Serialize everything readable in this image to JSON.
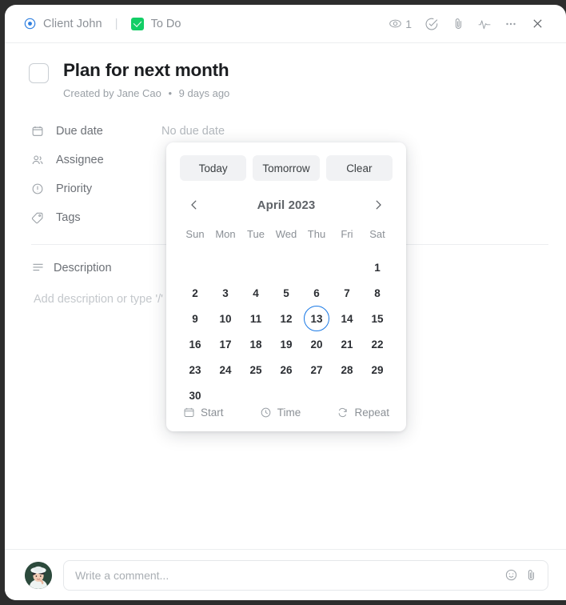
{
  "topbar": {
    "client": "Client John",
    "separator": "|",
    "status": "To Do",
    "view_count": "1",
    "icons": [
      "eye-icon",
      "check-circle-icon",
      "paperclip-icon",
      "activity-icon",
      "more-icon",
      "close-icon"
    ],
    "status_color": "#13ce66"
  },
  "task": {
    "title": "Plan for next month",
    "meta_author": "Created by Jane Cao",
    "meta_dot": "•",
    "meta_time": "9 days ago"
  },
  "fields": [
    {
      "label": "Due date",
      "value": "No due date",
      "icon": "calendar-icon"
    },
    {
      "label": "Assignee",
      "value": "",
      "icon": "people-icon"
    },
    {
      "label": "Priority",
      "value": "",
      "icon": "priority-flag-icon"
    },
    {
      "label": "Tags",
      "value": "",
      "icon": "tag-icon"
    }
  ],
  "description": {
    "title": "Description",
    "icon": "description-lines-icon",
    "placeholder": "Add description or type '/'"
  },
  "calendar": {
    "quick": [
      {
        "label": "Today"
      },
      {
        "label": "Tomorrow"
      },
      {
        "label": "Clear"
      }
    ],
    "prev_icon": "chevron-left-icon",
    "next_icon": "chevron-right-icon",
    "month": "April 2023",
    "weekdays": [
      "Sun",
      "Mon",
      "Tue",
      "Wed",
      "Thu",
      "Fri",
      "Sat"
    ],
    "leading_blanks": 6,
    "days": [
      1,
      2,
      3,
      4,
      5,
      6,
      7,
      8,
      9,
      10,
      11,
      12,
      13,
      14,
      15,
      16,
      17,
      18,
      19,
      20,
      21,
      22,
      23,
      24,
      25,
      26,
      27,
      28,
      29,
      30
    ],
    "today": 13,
    "today_ring_color": "#1a79e5",
    "footer": [
      {
        "label": "Start",
        "icon": "calendar-icon"
      },
      {
        "label": "Time",
        "icon": "clock-icon"
      },
      {
        "label": "Repeat",
        "icon": "repeat-icon"
      }
    ]
  },
  "comment": {
    "placeholder": "Write a comment...",
    "emoji_icon": "emoji-icon",
    "attach_icon": "paperclip-icon",
    "avatar": "user-avatar"
  }
}
